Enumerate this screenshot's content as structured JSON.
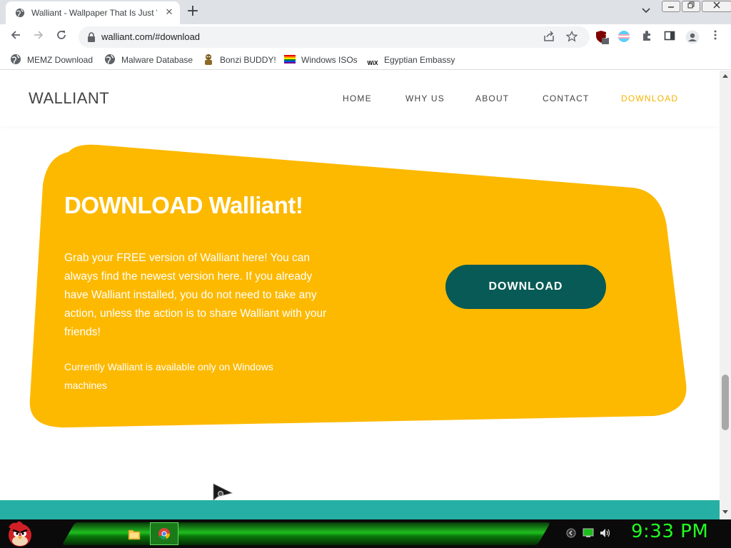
{
  "browser": {
    "tab_title": "Walliant - Wallpaper That Is Just Walliant",
    "tab_close": "✕",
    "new_tab": "+",
    "url": "walliant.com/#download",
    "extension_badge": "3",
    "bookmarks": [
      {
        "label": "MEMZ Download",
        "icon": "globe-icon"
      },
      {
        "label": "Malware Database",
        "icon": "globe-icon"
      },
      {
        "label": "Bonzi BUDDY!",
        "icon": "bonzi-icon"
      },
      {
        "label": "Windows ISOs",
        "icon": "rainbow-flag-icon"
      },
      {
        "label": "Egyptian Embassy",
        "icon": "wix-icon"
      }
    ],
    "wix_icon_text": "WiX"
  },
  "site": {
    "logo": "WALLIANT",
    "menu": [
      {
        "label": "HOME",
        "active": false
      },
      {
        "label": "WHY US",
        "active": false
      },
      {
        "label": "ABOUT",
        "active": false
      },
      {
        "label": "CONTACT",
        "active": false
      },
      {
        "label": "DOWNLOAD",
        "active": true
      }
    ],
    "download": {
      "title": "DOWNLOAD Walliant!",
      "text": "Grab your FREE version of Walliant here! You can always find the newest version here. If you already have Walliant installed, you do not need to take any action, unless the action is to share Walliant with your friends!",
      "note": "Currently Walliant is available only on Windows machines",
      "button": "DOWNLOAD"
    }
  },
  "taskbar": {
    "clock": "9:33 PM"
  },
  "colors": {
    "accent_yellow": "#fdb900",
    "active_menu": "#f5b301",
    "button_teal": "#075a55",
    "band_teal": "#26afa4",
    "clock_green": "#22ff22"
  }
}
